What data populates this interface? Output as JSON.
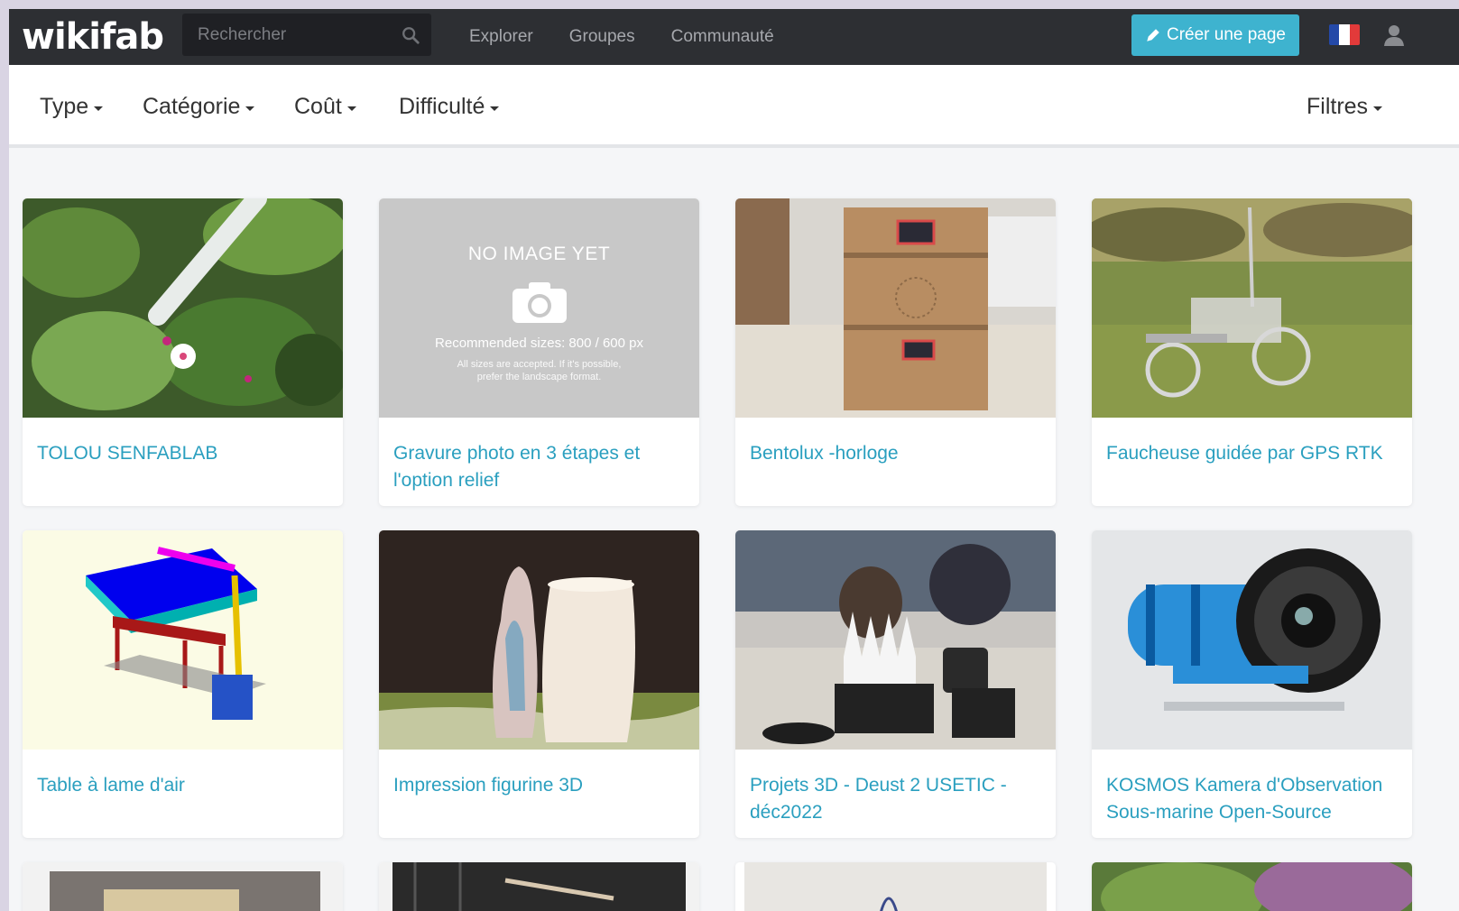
{
  "brand": {
    "logo": "wikifab"
  },
  "search": {
    "placeholder": "Rechercher"
  },
  "nav": {
    "links": [
      "Explorer",
      "Groupes",
      "Communauté"
    ],
    "create_label": "Créer une page"
  },
  "filters": {
    "type": "Type",
    "category": "Catégorie",
    "cost": "Coût",
    "difficulty": "Difficulté",
    "more": "Filtres"
  },
  "no_image": {
    "heading": "NO IMAGE YET",
    "sizes": "Recommended sizes: 800 / 600 px",
    "note1": "All sizes are accepted. If it's possible,",
    "note2": "prefer the landscape format."
  },
  "cards": [
    {
      "title": "TOLOU SENFABLAB",
      "image": "plants-photo"
    },
    {
      "title": "Gravure photo en 3 étapes et l'option relief",
      "image": "no-image-placeholder"
    },
    {
      "title": "Bentolux -horloge",
      "image": "wooden-clock-photo"
    },
    {
      "title": "Faucheuse guidée par GPS RTK",
      "image": "gps-mower-photo"
    },
    {
      "title": "Table à lame d'air",
      "image": "air-blade-table-render"
    },
    {
      "title": "Impression figurine 3D",
      "image": "3d-figurines-photo"
    },
    {
      "title": "Projets 3D - Deust 2 USETIC - déc2022",
      "image": "3d-projects-photo"
    },
    {
      "title": "KOSMOS Kamera d'Observation Sous-marine Open-Source",
      "image": "underwater-camera-photo"
    }
  ],
  "colors": {
    "navbar": "#2d2f33",
    "accent": "#3eb3cf",
    "link": "#2a9fbf"
  }
}
